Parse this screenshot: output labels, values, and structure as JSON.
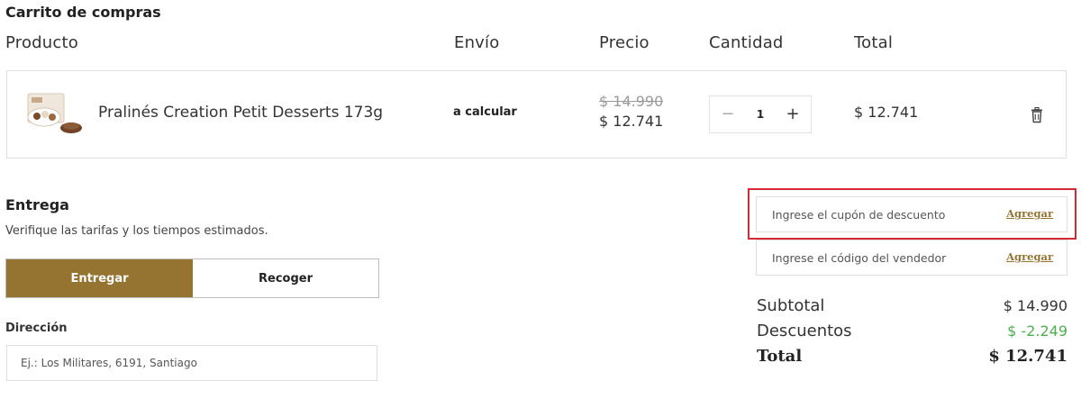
{
  "cart": {
    "title": "Carrito de compras",
    "columns": {
      "product": "Producto",
      "shipping": "Envío",
      "price": "Precio",
      "quantity": "Cantidad",
      "total": "Total"
    },
    "item": {
      "name": "Pralinés Creation Petit Desserts 173g",
      "shipping": "a calcular",
      "price_original": "$ 14.990",
      "price_current": "$ 12.741",
      "quantity": "1",
      "line_total": "$ 12.741",
      "minus_symbol": "−",
      "plus_symbol": "+"
    }
  },
  "delivery": {
    "title": "Entrega",
    "subtitle": "Verifique las tarifas y los tiempos estimados.",
    "options": [
      "Entregar",
      "Recoger"
    ],
    "selected": "Entregar",
    "address_label": "Dirección",
    "address_placeholder": "Ej.: Los Militares, 6191, Santiago"
  },
  "codes": {
    "coupon_placeholder": "Ingrese el cupón de descuento",
    "coupon_button": "Agregar",
    "seller_placeholder": "Ingrese el código del vendedor",
    "seller_button": "Agregar"
  },
  "summary": {
    "subtotal_label": "Subtotal",
    "subtotal_value": "$ 14.990",
    "discounts_label": "Descuentos",
    "discounts_value": "$ -2.249",
    "total_label": "Total",
    "total_value": "$ 12.741"
  },
  "colors": {
    "accent": "#957432",
    "highlight": "#d32a36",
    "discount": "#4caf50"
  },
  "icons": {
    "delete": "trash-icon",
    "product": "product-thumbnail"
  }
}
